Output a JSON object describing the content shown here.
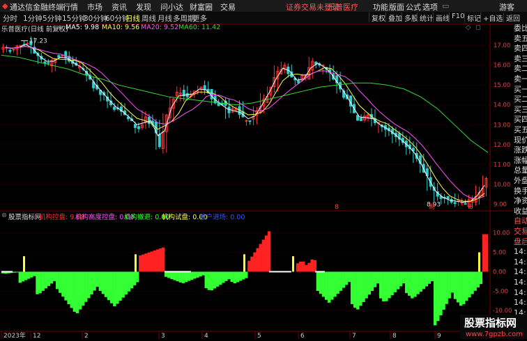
{
  "topbar": {
    "app_name": "通达信金融终端",
    "menu": [
      "行情",
      "市场",
      "资讯",
      "发现",
      "问小达",
      "财富圈",
      "交易"
    ],
    "notice": "证券交易未登录",
    "stock": "乐普医疗",
    "right_menu": [
      "功能",
      "版面",
      "公式",
      "选项"
    ],
    "guest": "游客"
  },
  "periodbar": {
    "tabs": [
      "分时",
      "1分钟",
      "5分钟",
      "15分钟",
      "30分钟",
      "60分钟",
      "日线",
      "周线",
      "月线",
      "多周期",
      "更多"
    ],
    "active": "日线",
    "right_buttons": [
      "复权",
      "叠加",
      "多股",
      "统计",
      "画线",
      "F10",
      "标记",
      "+自选",
      "返回"
    ]
  },
  "price_chart": {
    "title": "乐普医疗(日线 前复权)",
    "ma": [
      {
        "label": "MA5: 9.98",
        "color": "#ffffff"
      },
      {
        "label": "MA10: 9.56",
        "color": "#ffff55"
      },
      {
        "label": "MA20: 9.52",
        "color": "#ff55ff"
      },
      {
        "label": "MA60: 11.42",
        "color": "#33dd33"
      }
    ],
    "high_label": "17.23",
    "low_label": "8.93",
    "event_markers": [
      "8",
      "财",
      "8"
    ]
  },
  "indicator": {
    "name": "股票指标网",
    "items": [
      {
        "label": "机构控盘: 9.68",
        "color": "#ff3333"
      },
      {
        "label": "机构高度控盘: 0.00",
        "color": "#ff55ff"
      },
      {
        "label": "机构撤退: 0.00",
        "color": "#33ff33"
      },
      {
        "label": "机构试盘: 0.00",
        "color": "#ffff55"
      },
      {
        "label": "散户进场: 0.00",
        "color": "#3355ff"
      }
    ]
  },
  "right_panel": {
    "labels": [
      "委比",
      "卖五",
      "卖四",
      "卖三",
      "卖二",
      "卖一",
      "买一",
      "买二",
      "买三",
      "买四",
      "买五",
      "现价",
      "涨跌",
      "涨幅",
      "总量",
      "外盘",
      "换手",
      "净资",
      "收益",
      "自动",
      "交易",
      "盘后",
      "14:5",
      "14:5",
      "14:5",
      "14:5",
      "14:5",
      "14:5",
      "14:5",
      "14:5",
      "14:5"
    ],
    "side_labels": [
      "L",
      "SW"
    ]
  },
  "time_axis": [
    "2023年",
    "12",
    "2",
    "3",
    "4",
    "5",
    "6",
    "7",
    "8",
    "9"
  ],
  "watermark": {
    "title": "股票指标网",
    "url": "www.7gpzb.com"
  },
  "chart_data": {
    "type": "candlestick+bar",
    "price": {
      "ylim": [
        8.7,
        17.6
      ],
      "y_ticks": [
        "17.00",
        "16.00",
        "15.00",
        "14.00",
        "13.00",
        "12.00",
        "11.00",
        "10.00",
        "9.00"
      ],
      "approx_close": [
        16.9,
        16.8,
        17.0,
        17.1,
        16.6,
        16.3,
        16.1,
        16.3,
        16.5,
        16.2,
        16.0,
        15.8,
        15.3,
        14.8,
        14.5,
        14.0,
        13.8,
        13.5,
        13.2,
        12.8,
        13.4,
        13.0,
        11.9,
        13.5,
        14.3,
        14.6,
        14.4,
        14.7,
        14.9,
        14.6,
        14.1,
        14.0,
        13.6,
        13.8,
        13.4,
        13.2,
        13.7,
        14.3,
        14.9,
        15.7,
        16.0,
        15.4,
        15.1,
        15.5,
        16.2,
        16.0,
        15.8,
        15.3,
        14.8,
        14.3,
        13.6,
        13.2,
        13.5,
        13.1,
        12.9,
        12.7,
        12.4,
        12.1,
        11.8,
        11.3,
        10.6,
        9.9,
        9.4,
        9.3,
        9.1,
        9.2,
        9.0,
        9.3,
        9.6,
        10.3
      ],
      "ma60_approx": [
        16.5,
        16.4,
        16.2,
        16.0,
        15.8,
        15.5,
        15.3,
        15.0,
        14.8,
        14.6,
        14.4,
        14.3,
        14.2,
        14.1,
        14.0,
        14.1,
        14.3,
        14.5,
        14.7,
        14.9,
        15.0,
        15.1,
        15.1,
        15.0,
        14.8,
        14.4,
        13.8,
        13.0,
        12.2,
        11.6
      ]
    },
    "indicator": {
      "ylim": [
        -15,
        13
      ],
      "y_ticks": [
        "10.00",
        "5.00",
        "0.00",
        "-5.00",
        "-10.00"
      ],
      "last_value": 9.68
    }
  }
}
